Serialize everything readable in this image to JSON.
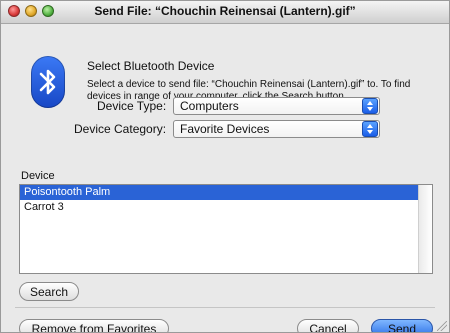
{
  "window": {
    "title": "Send File: “Chouchin Reinensai (Lantern).gif”"
  },
  "header": {
    "title": "Select Bluetooth Device",
    "description": "Select a device to send file: “Chouchin Reinensai (Lantern).gif” to.  To find devices in range of your computer, click the Search button."
  },
  "fields": {
    "device_type": {
      "label": "Device Type:",
      "value": "Computers"
    },
    "device_category": {
      "label": "Device Category:",
      "value": "Favorite Devices"
    }
  },
  "device_list": {
    "header": "Device",
    "items": [
      {
        "label": "Poisontooth Palm",
        "selected": true
      },
      {
        "label": "Carrot 3",
        "selected": false
      }
    ]
  },
  "buttons": {
    "search": "Search",
    "remove_favorites": "Remove from Favorites",
    "cancel": "Cancel",
    "send": "Send"
  },
  "colors": {
    "selection": "#2a63d6",
    "primary_button": "#2b6fe6",
    "bluetooth_icon": "#1f55dd"
  },
  "icons": [
    "close-button",
    "minimize-button",
    "zoom-button",
    "bluetooth-icon",
    "popup-stepper-icon",
    "resize-grip-icon"
  ]
}
